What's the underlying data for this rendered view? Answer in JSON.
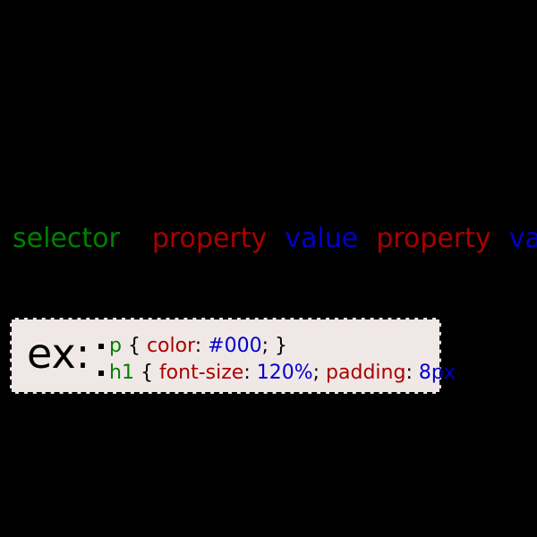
{
  "slide": {
    "background_color": "#000000",
    "palette": {
      "selector_color": "#008000",
      "property_color": "#aa0000",
      "value_color": "#0000cc",
      "punctuation_color": "#000000",
      "box_background": "#f0e8e6",
      "box_border_color": "#000000",
      "label_color": "#000000"
    }
  },
  "legend": {
    "items": [
      {
        "label": "selector",
        "role": "selector"
      },
      {
        "label": "property",
        "role": "property"
      },
      {
        "label": "value",
        "role": "value"
      },
      {
        "label": "property",
        "role": "property"
      },
      {
        "label": "value",
        "role": "value"
      }
    ]
  },
  "example": {
    "label": "ex:",
    "lines": [
      {
        "tokens": [
          {
            "text": "p",
            "role": "selector"
          },
          {
            "text": " { ",
            "role": "punctuation"
          },
          {
            "text": "color",
            "role": "property"
          },
          {
            "text": ": ",
            "role": "punctuation"
          },
          {
            "text": "#000",
            "role": "value"
          },
          {
            "text": "; }",
            "role": "punctuation"
          }
        ]
      },
      {
        "tokens": [
          {
            "text": "h1",
            "role": "selector"
          },
          {
            "text": " { ",
            "role": "punctuation"
          },
          {
            "text": "font-size",
            "role": "property"
          },
          {
            "text": ": ",
            "role": "punctuation"
          },
          {
            "text": "120%",
            "role": "value"
          },
          {
            "text": "; ",
            "role": "punctuation"
          },
          {
            "text": "padding",
            "role": "property"
          },
          {
            "text": ": ",
            "role": "punctuation"
          },
          {
            "text": "8px",
            "role": "value"
          }
        ]
      }
    ]
  }
}
